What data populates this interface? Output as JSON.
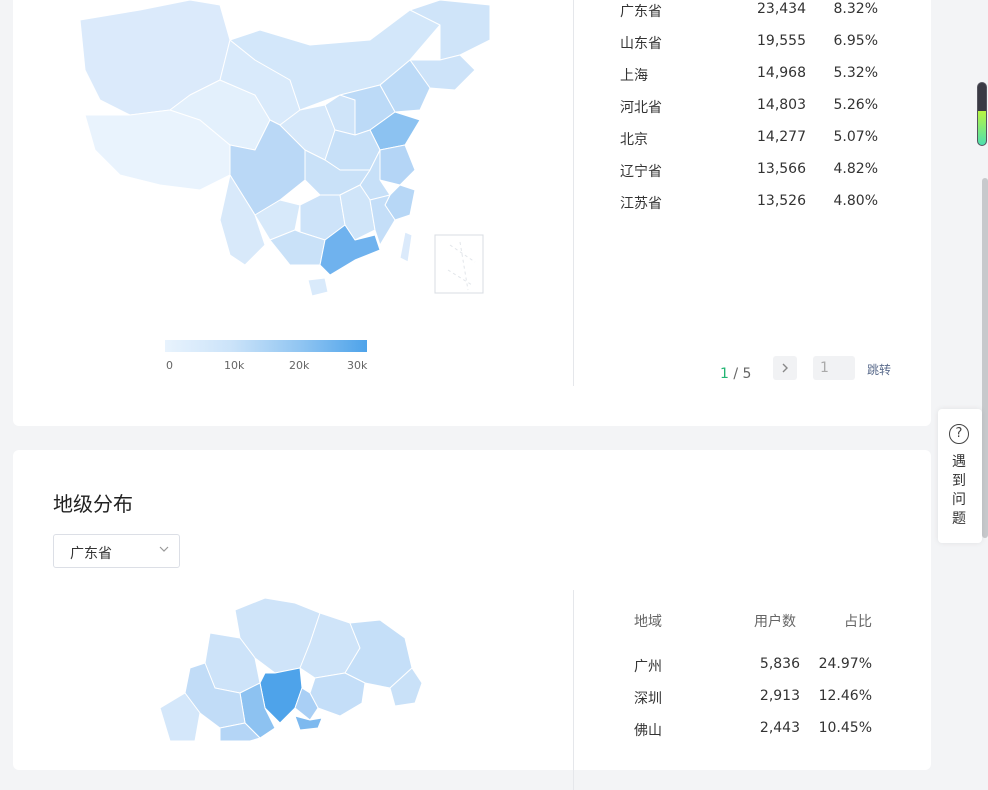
{
  "province_ranking": {
    "rows": [
      {
        "region": "广东省",
        "users": "23,434",
        "share": "8.32%"
      },
      {
        "region": "山东省",
        "users": "19,555",
        "share": "6.95%"
      },
      {
        "region": "上海",
        "users": "14,968",
        "share": "5.32%"
      },
      {
        "region": "河北省",
        "users": "14,803",
        "share": "5.26%"
      },
      {
        "region": "北京",
        "users": "14,277",
        "share": "5.07%"
      },
      {
        "region": "辽宁省",
        "users": "13,566",
        "share": "4.82%"
      },
      {
        "region": "江苏省",
        "users": "13,526",
        "share": "4.80%"
      }
    ],
    "legend": {
      "ticks": [
        "0",
        "10k",
        "20k",
        "30k"
      ]
    },
    "pagination": {
      "current": "1",
      "separator": "/",
      "total": "5",
      "next_icon": "chevron-right",
      "jump_value": "1",
      "jump_label": "跳转"
    }
  },
  "city_distribution": {
    "title": "地级分布",
    "province_select": {
      "value": "广东省",
      "icon": "chevron-down"
    },
    "headers": {
      "region": "地域",
      "users": "用户数",
      "share": "占比"
    },
    "rows": [
      {
        "region": "广州",
        "users": "5,836",
        "share": "24.97%"
      },
      {
        "region": "深圳",
        "users": "2,913",
        "share": "12.46%"
      },
      {
        "region": "佛山",
        "users": "2,443",
        "share": "10.45%"
      }
    ]
  },
  "help_widget": {
    "icon": "question-circle",
    "label": "遇到问题"
  },
  "indicator": {
    "level": 0.55
  },
  "colors": {
    "map_scale": [
      "#e8f3fd",
      "#cbe3f9",
      "#92c6f2",
      "#4ea3ea"
    ],
    "page_bg": "#f3f4f6",
    "pager_current": "#22b573"
  }
}
